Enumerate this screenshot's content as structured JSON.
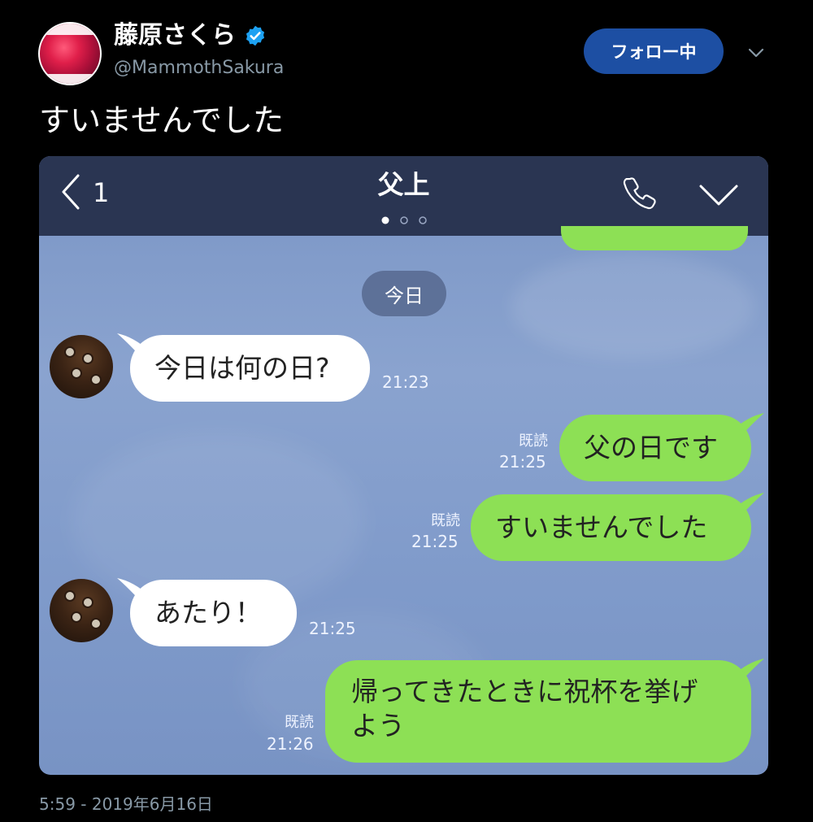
{
  "tweet": {
    "display_name": "藤原さくら",
    "handle": "@MammothSakura",
    "follow_label": "フォロー中",
    "text": "すいませんでした",
    "timestamp": "5:59 - 2019年6月16日",
    "accent_color": "#1d4fa3"
  },
  "line_chat": {
    "back_count": "1",
    "title": "父上",
    "date_separator": "今日",
    "messages": [
      {
        "side": "in",
        "text": "今日は何の日?",
        "time": "21:23"
      },
      {
        "side": "out",
        "text": "父の日です",
        "read": "既読",
        "time": "21:25"
      },
      {
        "side": "out",
        "text": "すいませんでした",
        "read": "既読",
        "time": "21:25"
      },
      {
        "side": "in",
        "text": "あたり！",
        "time": "21:25"
      },
      {
        "side": "out",
        "text_line1": "帰ってきたときに祝杯を挙げ",
        "text_line2": "よう",
        "read": "既読",
        "time": "21:26"
      }
    ],
    "colors": {
      "header": "#2a3552",
      "background": "#7f9aca",
      "outgoing_bubble": "#8de055",
      "incoming_bubble": "#ffffff"
    }
  }
}
